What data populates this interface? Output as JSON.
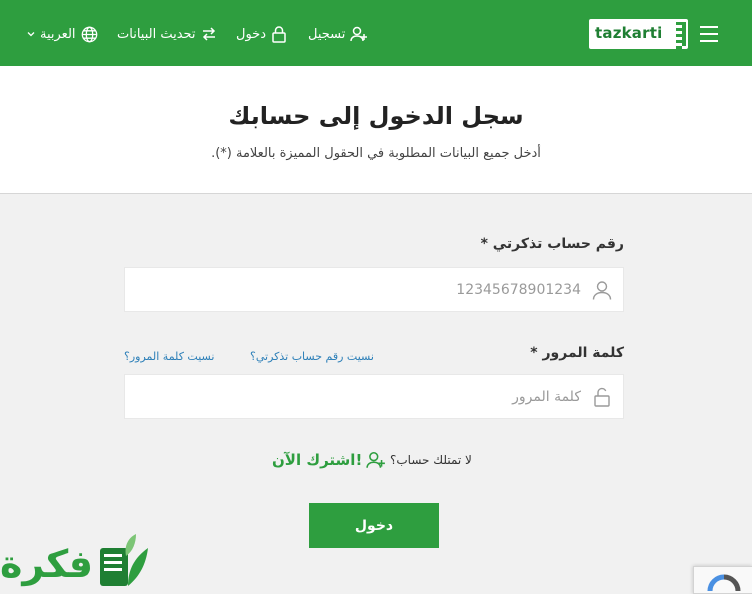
{
  "header": {
    "logo_text": "tazkarti",
    "nav": {
      "register": "تسجيل",
      "login": "دخول",
      "update_data": "تحديث البيانات",
      "language": "العربية"
    },
    "icons": [
      "menu-icon",
      "user-plus-icon",
      "lock-icon",
      "swap-icon",
      "globe-icon",
      "chevron-down-icon"
    ],
    "accent_color": "#2e9e3f"
  },
  "page": {
    "title": "سجل الدخول إلى حسابك",
    "subtitle": "أدخل جميع البيانات المطلوبة في الحقول المميزة بالعلامة (*)."
  },
  "form": {
    "account_label": "رقم حساب تذكرتي *",
    "account_placeholder": "12345678901234",
    "password_label": "كلمة المرور *",
    "password_placeholder": "كلمة المرور",
    "forgot_account": "نسيت رقم حساب تذكرتي؟",
    "forgot_password": "نسيت كلمة المرور؟",
    "no_account": "لا تمتلك حساب؟",
    "signup_now": "اشترك الآن!",
    "login_button": "دخول"
  },
  "watermark": {
    "text": "فكرة"
  }
}
